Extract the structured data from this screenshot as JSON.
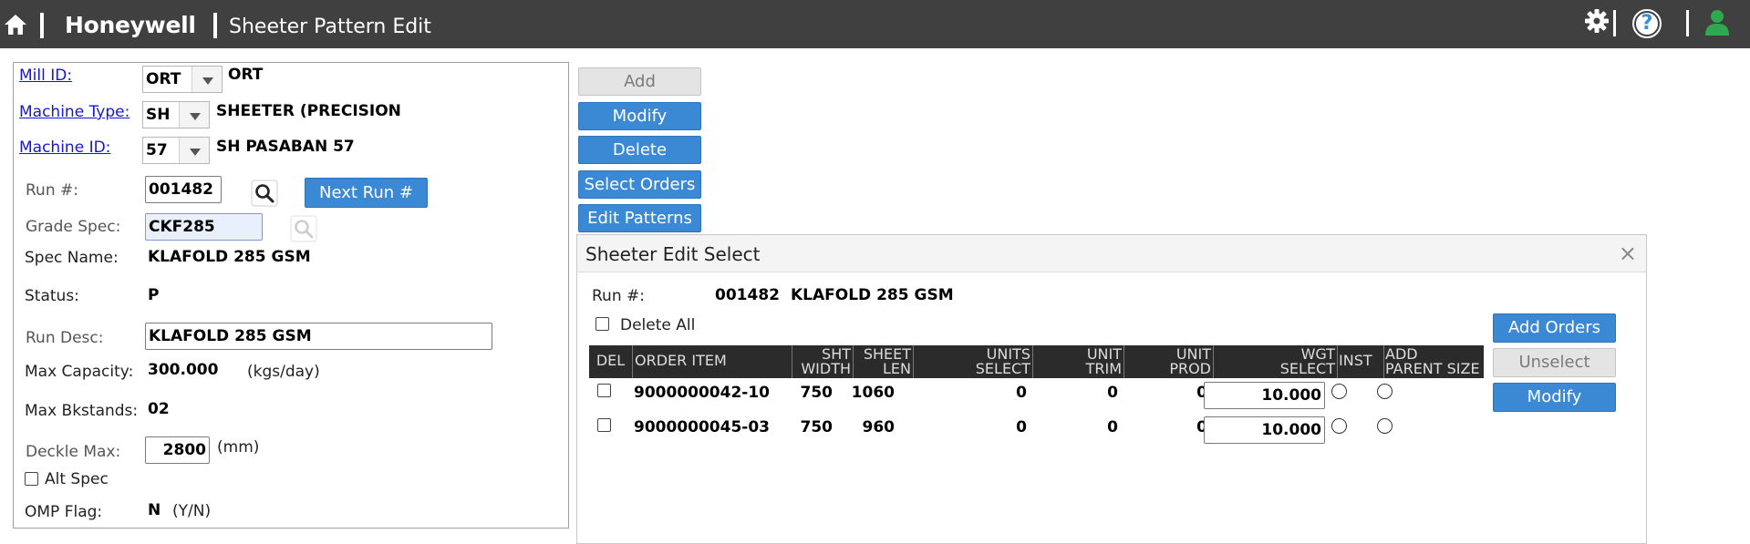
{
  "header": {
    "brand": "Honeywell",
    "title": "Sheeter Pattern Edit"
  },
  "form": {
    "mill_id": {
      "label": "Mill ID:",
      "value": "ORT",
      "desc": "ORT"
    },
    "machine_type": {
      "label": "Machine Type:",
      "value": "SH",
      "desc": "SHEETER (PRECISION"
    },
    "machine_id": {
      "label": "Machine ID:",
      "value": "57",
      "desc": "SH PASABAN 57"
    },
    "run": {
      "label": "Run #:",
      "value": "001482",
      "next_button": "Next Run #"
    },
    "grade_spec": {
      "label": "Grade Spec:",
      "value": "CKF285"
    },
    "spec_name": {
      "label": "Spec Name:",
      "value": "KLAFOLD 285 GSM"
    },
    "status": {
      "label": "Status:",
      "value": "P"
    },
    "run_desc": {
      "label": "Run Desc:",
      "value": "KLAFOLD 285 GSM"
    },
    "max_capacity": {
      "label": "Max Capacity:",
      "value": "300.000",
      "unit": "(kgs/day)"
    },
    "max_bkstands": {
      "label": "Max Bkstands:",
      "value": "02"
    },
    "deckle_max": {
      "label": "Deckle Max:",
      "value": "2800",
      "unit": "(mm)"
    },
    "alt_spec": {
      "label": "Alt Spec"
    },
    "omp_flag": {
      "label": "OMP Flag:",
      "value": "N",
      "hint": "(Y/N)"
    }
  },
  "actions": {
    "add": "Add",
    "modify": "Modify",
    "delete": "Delete",
    "select_orders": "Select Orders",
    "edit_patterns": "Edit Patterns"
  },
  "modal": {
    "title": "Sheeter Edit Select",
    "close": "×",
    "run_label": "Run #:",
    "run_value": "001482",
    "run_desc": "KLAFOLD 285 GSM",
    "delete_all": "Delete All",
    "columns": {
      "del": "DEL",
      "order_item": "ORDER ITEM",
      "sht_width": [
        "SHT",
        "WIDTH"
      ],
      "sheet_len": [
        "SHEET",
        "LEN"
      ],
      "units_select": [
        "UNITS",
        "SELECT"
      ],
      "unit_trim": [
        "UNIT",
        "TRIM"
      ],
      "unit_prod": [
        "UNIT",
        "PROD"
      ],
      "wgt_select": [
        "WGT",
        "SELECT"
      ],
      "inst": "INST",
      "add_parent_size": [
        "ADD",
        "PARENT SIZE"
      ]
    },
    "rows": [
      {
        "order_item": "9000000042-10",
        "sht_width": "750",
        "sheet_len": "1060",
        "units_select": "0",
        "unit_trim": "0",
        "unit_prod": "0",
        "wgt_select": "10.000"
      },
      {
        "order_item": "9000000045-03",
        "sht_width": "750",
        "sheet_len": "960",
        "units_select": "0",
        "unit_trim": "0",
        "unit_prod": "0",
        "wgt_select": "10.000"
      }
    ],
    "buttons": {
      "add_orders": "Add Orders",
      "unselect": "Unselect",
      "modify": "Modify"
    }
  },
  "colors": {
    "topbar": "#404040",
    "primary_button": "#3b89d4",
    "link": "#1515e0",
    "user_icon": "#2fa84f"
  }
}
